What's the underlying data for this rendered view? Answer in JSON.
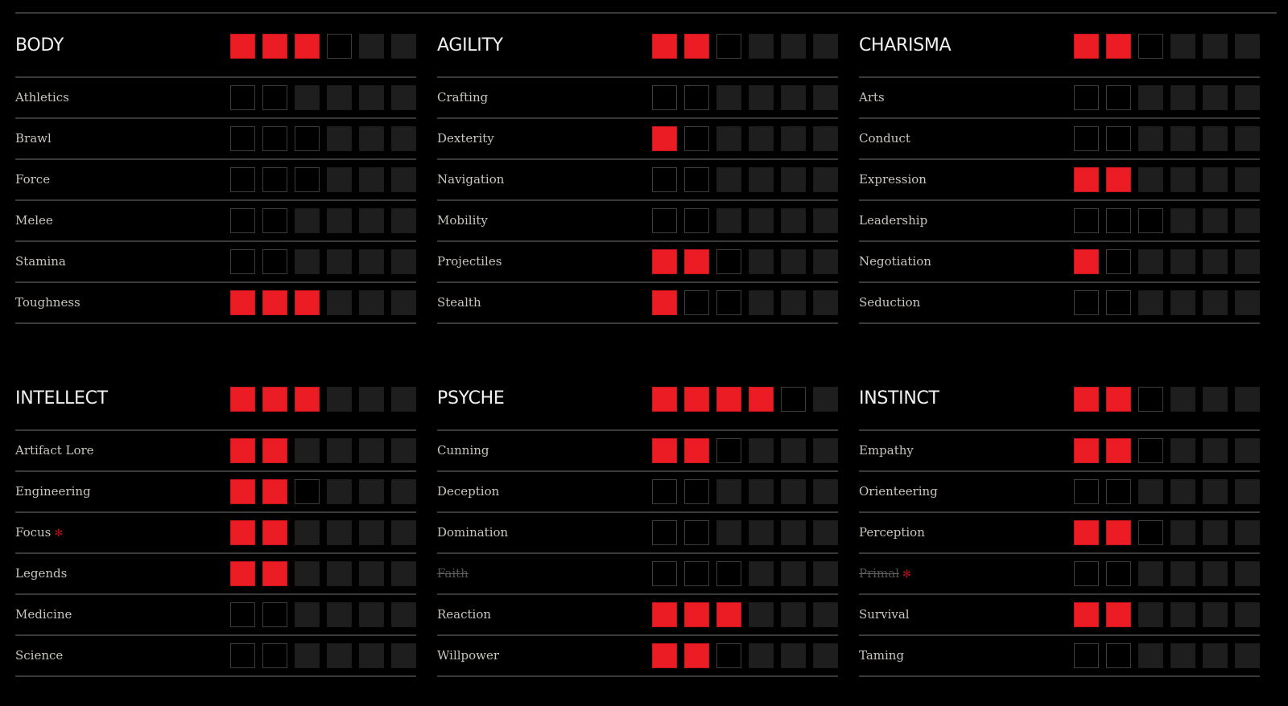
{
  "max_rating": 6,
  "colors": {
    "filled": "#ec1c24",
    "empty_border": "#3c3c3c",
    "locked": "#1e1e1e",
    "background": "#000000",
    "marker": "#b3121a"
  },
  "attributes": [
    {
      "name": "BODY",
      "rating": 3,
      "cap": 4,
      "skills": [
        {
          "name": "Athletics",
          "rating": 0,
          "cap": 2,
          "disabled": false,
          "marked": false
        },
        {
          "name": "Brawl",
          "rating": 0,
          "cap": 3,
          "disabled": false,
          "marked": false
        },
        {
          "name": "Force",
          "rating": 0,
          "cap": 3,
          "disabled": false,
          "marked": false
        },
        {
          "name": "Melee",
          "rating": 0,
          "cap": 2,
          "disabled": false,
          "marked": false
        },
        {
          "name": "Stamina",
          "rating": 0,
          "cap": 2,
          "disabled": false,
          "marked": false
        },
        {
          "name": "Toughness",
          "rating": 3,
          "cap": 3,
          "disabled": false,
          "marked": false
        }
      ]
    },
    {
      "name": "AGILITY",
      "rating": 2,
      "cap": 3,
      "skills": [
        {
          "name": "Crafting",
          "rating": 0,
          "cap": 2,
          "disabled": false,
          "marked": false
        },
        {
          "name": "Dexterity",
          "rating": 1,
          "cap": 2,
          "disabled": false,
          "marked": false
        },
        {
          "name": "Navigation",
          "rating": 0,
          "cap": 2,
          "disabled": false,
          "marked": false
        },
        {
          "name": "Mobility",
          "rating": 0,
          "cap": 2,
          "disabled": false,
          "marked": false
        },
        {
          "name": "Projectiles",
          "rating": 2,
          "cap": 3,
          "disabled": false,
          "marked": false
        },
        {
          "name": "Stealth",
          "rating": 1,
          "cap": 3,
          "disabled": false,
          "marked": false
        }
      ]
    },
    {
      "name": "CHARISMA",
      "rating": 2,
      "cap": 3,
      "skills": [
        {
          "name": "Arts",
          "rating": 0,
          "cap": 2,
          "disabled": false,
          "marked": false
        },
        {
          "name": "Conduct",
          "rating": 0,
          "cap": 2,
          "disabled": false,
          "marked": false
        },
        {
          "name": "Expression",
          "rating": 2,
          "cap": 2,
          "disabled": false,
          "marked": false
        },
        {
          "name": "Leadership",
          "rating": 0,
          "cap": 3,
          "disabled": false,
          "marked": false
        },
        {
          "name": "Negotiation",
          "rating": 1,
          "cap": 2,
          "disabled": false,
          "marked": false
        },
        {
          "name": "Seduction",
          "rating": 0,
          "cap": 2,
          "disabled": false,
          "marked": false
        }
      ]
    },
    {
      "name": "INTELLECT",
      "rating": 3,
      "cap": 3,
      "skills": [
        {
          "name": "Artifact Lore",
          "rating": 2,
          "cap": 2,
          "disabled": false,
          "marked": false
        },
        {
          "name": "Engineering",
          "rating": 2,
          "cap": 3,
          "disabled": false,
          "marked": false
        },
        {
          "name": "Focus",
          "rating": 2,
          "cap": 2,
          "disabled": false,
          "marked": true
        },
        {
          "name": "Legends",
          "rating": 2,
          "cap": 2,
          "disabled": false,
          "marked": false
        },
        {
          "name": "Medicine",
          "rating": 0,
          "cap": 2,
          "disabled": false,
          "marked": false
        },
        {
          "name": "Science",
          "rating": 0,
          "cap": 2,
          "disabled": false,
          "marked": false
        }
      ]
    },
    {
      "name": "PSYCHE",
      "rating": 4,
      "cap": 5,
      "skills": [
        {
          "name": "Cunning",
          "rating": 2,
          "cap": 3,
          "disabled": false,
          "marked": false
        },
        {
          "name": "Deception",
          "rating": 0,
          "cap": 2,
          "disabled": false,
          "marked": false
        },
        {
          "name": "Domination",
          "rating": 0,
          "cap": 2,
          "disabled": false,
          "marked": false
        },
        {
          "name": "Faith",
          "rating": 0,
          "cap": 3,
          "disabled": true,
          "marked": false
        },
        {
          "name": "Reaction",
          "rating": 3,
          "cap": 3,
          "disabled": false,
          "marked": false
        },
        {
          "name": "Willpower",
          "rating": 2,
          "cap": 3,
          "disabled": false,
          "marked": false
        }
      ]
    },
    {
      "name": "INSTINCT",
      "rating": 2,
      "cap": 3,
      "skills": [
        {
          "name": "Empathy",
          "rating": 2,
          "cap": 3,
          "disabled": false,
          "marked": false
        },
        {
          "name": "Orienteering",
          "rating": 0,
          "cap": 2,
          "disabled": false,
          "marked": false
        },
        {
          "name": "Perception",
          "rating": 2,
          "cap": 3,
          "disabled": false,
          "marked": false
        },
        {
          "name": "Primal",
          "rating": 0,
          "cap": 2,
          "disabled": true,
          "marked": true
        },
        {
          "name": "Survival",
          "rating": 2,
          "cap": 2,
          "disabled": false,
          "marked": false
        },
        {
          "name": "Taming",
          "rating": 0,
          "cap": 2,
          "disabled": false,
          "marked": false
        }
      ]
    }
  ],
  "marker_glyph": "✻"
}
